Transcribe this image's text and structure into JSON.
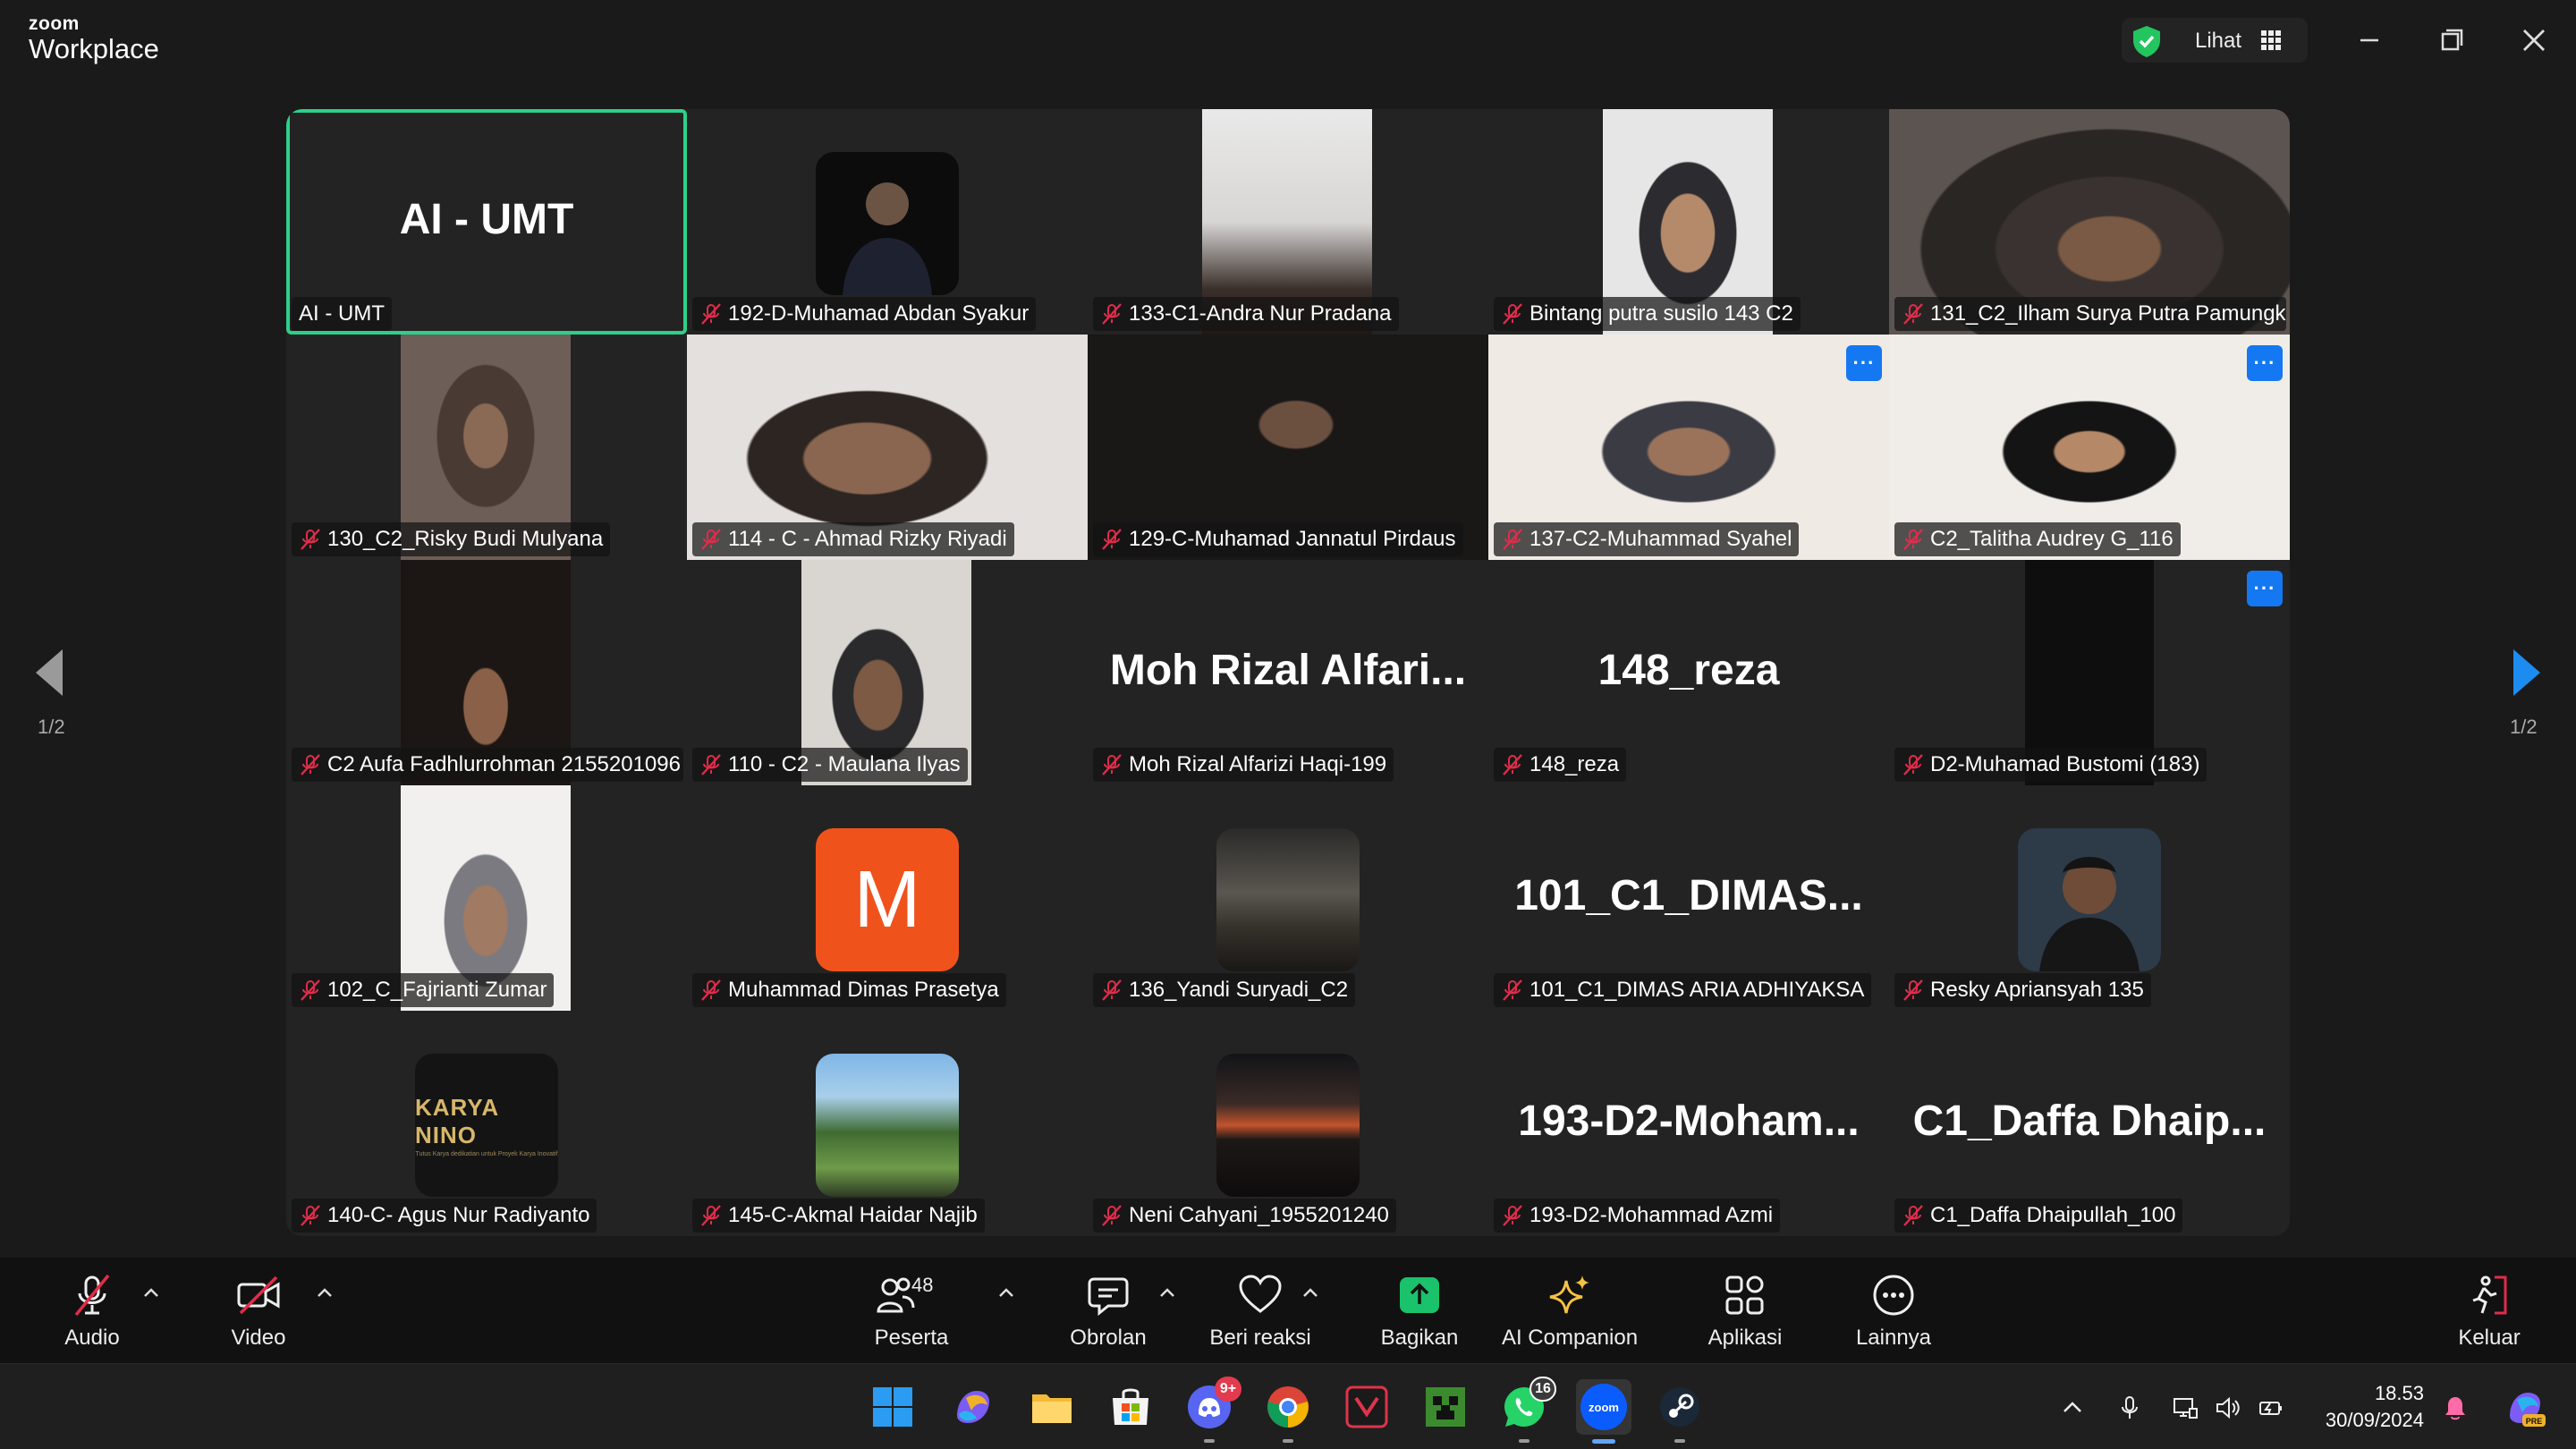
{
  "app": {
    "brand_small": "zoom",
    "brand_name": "Workplace"
  },
  "header": {
    "view_label": "Lihat",
    "shield_color": "#22c55e"
  },
  "gallery": {
    "page_left": "1/2",
    "page_right": "1/2",
    "tiles": [
      {
        "label": "AI - UMT",
        "big": "AI - UMT",
        "active": true
      },
      {
        "label": "192-D-Muhamad Abdan Syakur"
      },
      {
        "label": "133-C1-Andra Nur Pradana"
      },
      {
        "label": "Bintang putra susilo 143 C2"
      },
      {
        "label": "131_C2_Ilham Surya Putra Pamungk..."
      },
      {
        "label": "130_C2_Risky Budi Mulyana"
      },
      {
        "label": "114 - C - Ahmad Rizky Riyadi"
      },
      {
        "label": "129-C-Muhamad Jannatul Pirdaus"
      },
      {
        "label": "137-C2-Muhammad Syahel"
      },
      {
        "label": "C2_Talitha Audrey G_116"
      },
      {
        "label": "C2 Aufa Fadhlurrohman 2155201096"
      },
      {
        "label": "110 - C2 - Maulana Ilyas"
      },
      {
        "label": "Moh Rizal Alfarizi Haqi-199",
        "big": "Moh Rizal Alfari..."
      },
      {
        "label": "148_reza",
        "big": "148_reza"
      },
      {
        "label": "D2-Muhamad Bustomi (183)"
      },
      {
        "label": "102_C_Fajrianti Zumar"
      },
      {
        "label": "Muhammad Dimas Prasetya",
        "avatar_letter": "M"
      },
      {
        "label": "136_Yandi Suryadi_C2"
      },
      {
        "label": "101_C1_DIMAS ARIA ADHIYAKSA",
        "big": "101_C1_DIMAS..."
      },
      {
        "label": "Resky Apriansyah 135"
      },
      {
        "label": "140-C- Agus Nur Radiyanto",
        "avatar_text": "KARYA NINO",
        "avatar_subtext": "Tutus Karya dedikatian untuk Proyek Karya Inovatif"
      },
      {
        "label": "145-C-Akmal Haidar Najib"
      },
      {
        "label": "Neni Cahyani_1955201240"
      },
      {
        "label": "193-D2-Mohammad Azmi",
        "big": "193-D2-Moham..."
      },
      {
        "label": "C1_Daffa Dhaipullah_100",
        "big": "C1_Daffa Dhaip..."
      }
    ]
  },
  "toolbar": {
    "audio": "Audio",
    "video": "Video",
    "participants": "Peserta",
    "participants_count": "48",
    "chat": "Obrolan",
    "react": "Beri reaksi",
    "share": "Bagikan",
    "ai_companion": "AI Companion",
    "apps": "Aplikasi",
    "more": "Lainnya",
    "leave": "Keluar",
    "share_color": "#19c26b",
    "mute_color": "#e02c4a"
  },
  "taskbar": {
    "discord_badge": "9+",
    "whatsapp_badge": "16",
    "zoom_label": "zoom",
    "time": "18.53",
    "date": "30/09/2024"
  }
}
